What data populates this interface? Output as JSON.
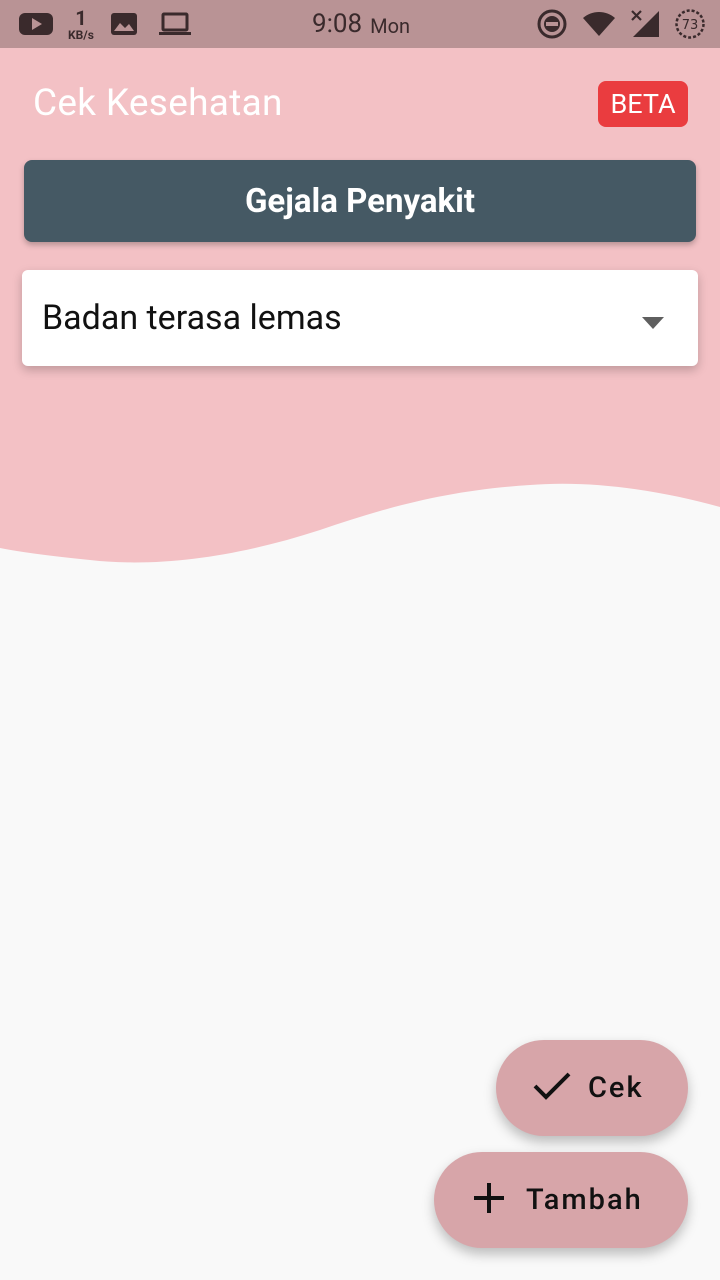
{
  "status_bar": {
    "time": "9:08",
    "day": "Mon",
    "net_speed_value": "1",
    "net_speed_unit": "KB/s",
    "battery_level": "73",
    "left_icons": [
      "youtube-icon",
      "image-icon",
      "laptop-icon"
    ],
    "right_icons": [
      "do-not-disturb-icon",
      "wifi-icon",
      "no-signal-icon",
      "battery-icon"
    ]
  },
  "header": {
    "title": "Cek Kesehatan",
    "badge": "BETA"
  },
  "section": {
    "title": "Gejala Penyakit"
  },
  "symptom_dropdown": {
    "selected": "Badan terasa lemas"
  },
  "actions": {
    "check_label": "Cek",
    "add_label": "Tambah"
  },
  "colors": {
    "top_background": "#f3c1c5",
    "status_bar": "#b99395",
    "section_header": "#455964",
    "beta_badge": "#ea3c3f",
    "fab": "#d7a5a9",
    "page_background": "#f9f9f9"
  }
}
